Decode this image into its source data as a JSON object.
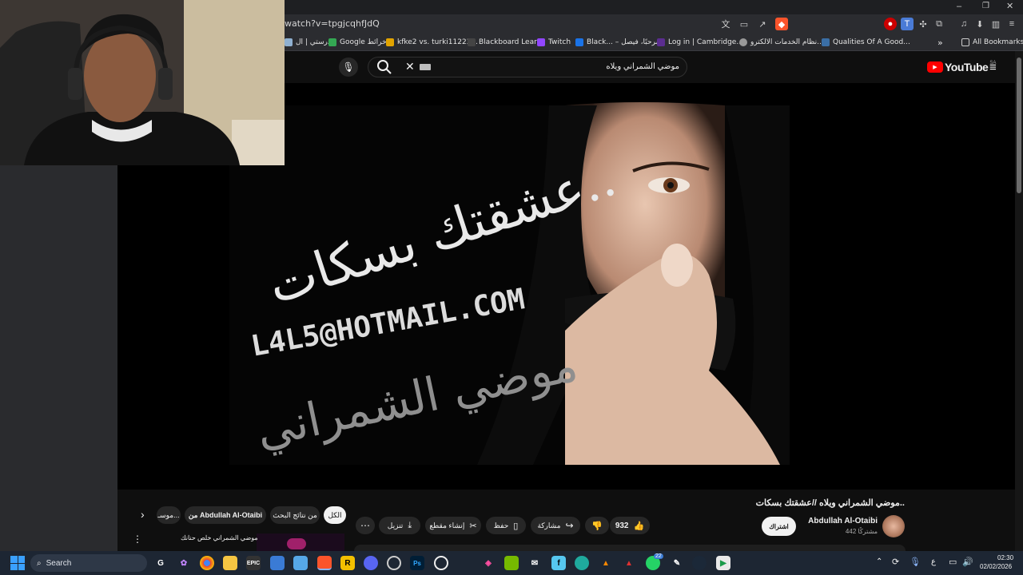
{
  "browser": {
    "url": "watch?v=tpgjcqhfJdQ",
    "bookmarks": [
      {
        "label": "مدرستي | ال",
        "color": "#8fb0d0"
      },
      {
        "label": "Google خرائط",
        "color": "#34a853"
      },
      {
        "label": "kfke2 vs. turki11223...",
        "color": "#e2a400"
      },
      {
        "label": "Blackboard Learn",
        "color": "#222222"
      },
      {
        "label": "Twitch",
        "color": "#9146ff"
      },
      {
        "label": "Black... – مرحبًا، فيصل",
        "color": "#1a73e8"
      },
      {
        "label": "Log in | Cambridge...",
        "color": "#5b2d90"
      },
      {
        "label": "نظام الخدمات الالكترو...",
        "color": "#999999"
      },
      {
        "label": "Qualities Of A Good...",
        "color": "#3a6ea5"
      }
    ],
    "overflow_label": "»",
    "all_bookmarks": "All Bookmarks"
  },
  "youtube": {
    "logo": "YouTube",
    "region": "SA",
    "search_value": "موضي الشمراني ويلاه",
    "video_overlay": {
      "line1": "عشقتك بسكات..",
      "email": "L4L5@HOTMAIL.COM",
      "artist": "موضي الشمراني"
    },
    "title": "موضي الشمراني ويلاه //عشقتك بسكات..",
    "channel_name": "Abdullah Al-Otaibi",
    "subscribers": "442 مشتركًا",
    "subscribe": "اشتراك",
    "like_count": "932",
    "share": "مشاركة",
    "save": "حفظ",
    "clip": "إنشاء مقطع",
    "download": "تنزيل",
    "more": "⋯",
    "chips": [
      "الكل",
      "من نتائج البحث",
      "من Abdullah Al-Otaibi",
      "موسـ..."
    ],
    "related_title": "موضي الشمراني خلص حنانك",
    "related_menu": "⋮"
  },
  "taskbar": {
    "search": "Search",
    "lang": "ع",
    "time": "02:30",
    "date": "02/02/2026",
    "whatsapp_badge": "22"
  },
  "colors": {
    "youtube_red": "#ff0000",
    "chip_active_bg": "#f1f1f1",
    "taskbar": "#1d2633"
  }
}
